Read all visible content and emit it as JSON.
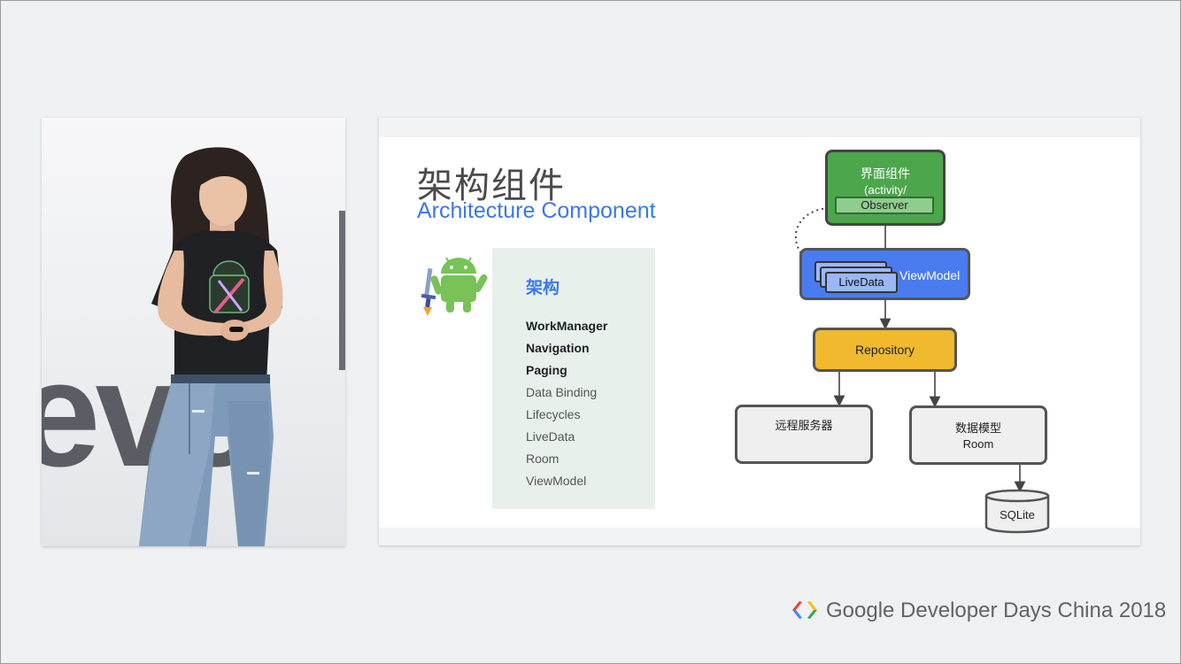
{
  "video": {
    "backdrop_text": "eve"
  },
  "slide": {
    "title": "架构组件",
    "subtitle": "Architecture Component",
    "list": {
      "heading": "架构",
      "items": [
        {
          "label": "WorkManager",
          "new": true
        },
        {
          "label": "Navigation",
          "new": true
        },
        {
          "label": "Paging",
          "new": true
        },
        {
          "label": "Data Binding",
          "new": false
        },
        {
          "label": "Lifecycles",
          "new": false
        },
        {
          "label": "LiveData",
          "new": false
        },
        {
          "label": "Room",
          "new": false
        },
        {
          "label": "ViewModel",
          "new": false
        }
      ]
    },
    "diagram": {
      "ui_component": {
        "title": "界面组件",
        "subtitle": "(activity/",
        "observer": "Observer"
      },
      "viewmodel": {
        "label": "ViewModel",
        "livedata": "LiveData"
      },
      "repository": "Repository",
      "remote_server": "远程服务器",
      "data_model": {
        "title": "数据模型",
        "subtitle": "Room"
      },
      "sqlite": "SQLite"
    },
    "colors": {
      "ui_green": "#4ca64c",
      "viewmodel_blue": "#4a7cf0",
      "repository_yellow": "#f0b92e",
      "accent_blue": "#3b78e7"
    }
  },
  "footer": {
    "brand": "Google Developer Days",
    "event": "China 2018"
  }
}
